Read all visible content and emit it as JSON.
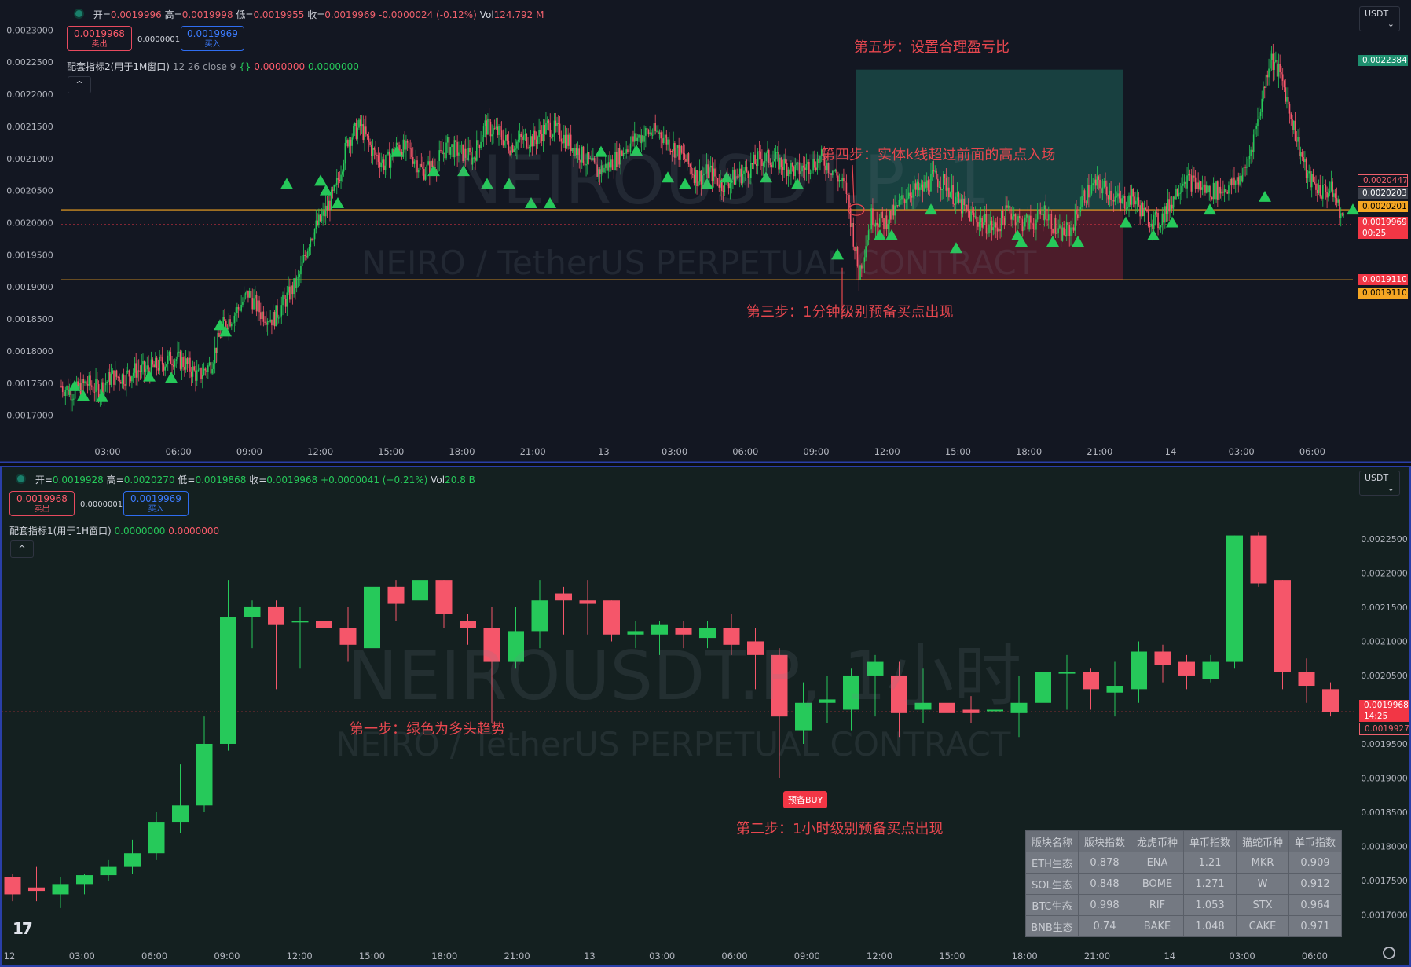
{
  "colors": {
    "up": "#26c95a",
    "down": "#f5566a",
    "hline": "#f5a623",
    "note": "#e8474f",
    "accent": "#2a3fa8"
  },
  "top": {
    "ohlc": {
      "open_label": "开=",
      "open": "0.0019996",
      "high_label": "高=",
      "high": "0.0019998",
      "low_label": "低=",
      "low": "0.0019955",
      "close_label": "收=",
      "close": "0.0019969",
      "change": "-0.0000024 (-0.12%)",
      "vol_label": "Vol",
      "vol": "124.792 M"
    },
    "sell": {
      "price": "0.0019968",
      "label": "卖出"
    },
    "buy": {
      "price": "0.0019969",
      "label": "买入"
    },
    "spread": "0.0000001",
    "indicator": {
      "name": "配套指标2(用于1M窗口)",
      "params": "12 26 close 9",
      "brace_icon": "{}",
      "v1": "0.0000000",
      "v2": "0.0000000"
    },
    "collapse": "^",
    "currency": "USDT",
    "watermark": {
      "symbol": "NEIROUSDT.P, 1",
      "name": "NEIRO / TetherUS PERPETUAL CONTRACT"
    },
    "notes": [
      "第五步：设置合理盈亏比",
      "第四步：实体k线超过前面的高点入场",
      "第三步：1分钟级别预备买点出现"
    ],
    "y_ticks": [
      "0.0023000",
      "0.0022500",
      "0.0022000",
      "0.0021500",
      "0.0021000",
      "0.0020500",
      "0.0020000",
      "0.0019500",
      "0.0019000",
      "0.0018500",
      "0.0018000",
      "0.0017500",
      "0.0017000"
    ],
    "x_ticks": [
      "03:00",
      "06:00",
      "09:00",
      "12:00",
      "15:00",
      "18:00",
      "21:00",
      "13",
      "03:00",
      "06:00",
      "09:00",
      "12:00",
      "15:00",
      "18:00",
      "21:00",
      "14",
      "03:00",
      "06:00"
    ],
    "price_labels": [
      {
        "text": "0.0022384",
        "bg": "#1e8f6f",
        "fg": "#ffffff"
      },
      {
        "text": "0.0020447",
        "bg": "#131722",
        "fg": "#f0616d"
      },
      {
        "text": "0.0020203",
        "bg": "#3b3f4a",
        "fg": "#ffffff"
      },
      {
        "text": "0.0020201",
        "bg": "#f5a623",
        "fg": "#000000"
      },
      {
        "text": "0.0019969",
        "bg": "#f23645",
        "fg": "#ffffff"
      },
      {
        "text": "00:25",
        "bg": "#f23645",
        "fg": "#ffffff"
      },
      {
        "text": "0.0019110",
        "bg": "#f23645",
        "fg": "#ffffff"
      },
      {
        "text": "0.0019110",
        "bg": "#f5a623",
        "fg": "#000000"
      }
    ]
  },
  "bottom": {
    "ohlc": {
      "open_label": "开=",
      "open": "0.0019928",
      "high_label": "高=",
      "high": "0.0020270",
      "low_label": "低=",
      "low": "0.0019868",
      "close_label": "收=",
      "close": "0.0019968",
      "change": "+0.0000041 (+0.21%)",
      "vol_label": "Vol",
      "vol": "20.8 B"
    },
    "sell": {
      "price": "0.0019968",
      "label": "卖出"
    },
    "buy": {
      "price": "0.0019969",
      "label": "买入"
    },
    "spread": "0.0000001",
    "indicator": {
      "name": "配套指标1(用于1H窗口)",
      "v1": "0.0000000",
      "v2": "0.0000000"
    },
    "collapse": "^",
    "currency": "USDT",
    "watermark": {
      "symbol": "NEIROUSDT.P, 1小时",
      "name": "NEIRO / TetherUS PERPETUAL CONTRACT"
    },
    "notes": [
      "第一步：绿色为多头趋势",
      "第二步：1小时级别预备买点出现"
    ],
    "buy_tag": "预备BUY",
    "y_ticks": [
      "0.0022500",
      "0.0022000",
      "0.0021500",
      "0.0021000",
      "0.0020500",
      "0.0020000",
      "0.0019500",
      "0.0019000",
      "0.0018500",
      "0.0018000",
      "0.0017500",
      "0.0017000"
    ],
    "x_ticks": [
      "12",
      "03:00",
      "06:00",
      "09:00",
      "12:00",
      "15:00",
      "18:00",
      "21:00",
      "13",
      "03:00",
      "06:00",
      "09:00",
      "12:00",
      "15:00",
      "18:00",
      "21:00",
      "14",
      "03:00",
      "06:00"
    ],
    "price_labels": [
      {
        "text": "0.0019968",
        "bg": "#f23645",
        "fg": "#ffffff"
      },
      {
        "text": "14:25",
        "bg": "#f23645",
        "fg": "#ffffff"
      },
      {
        "text": "0.0019927",
        "bg": "#142020",
        "fg": "#f0616d"
      }
    ],
    "tv_logo": "17",
    "settings_icon": "gear-icon"
  },
  "sector_table": {
    "headers": [
      "版块名称",
      "版块指数",
      "龙虎币种",
      "单币指数",
      "猫蛇币种",
      "单币指数"
    ],
    "rows": [
      [
        "ETH生态",
        "0.878",
        "ENA",
        "1.21",
        "MKR",
        "0.909"
      ],
      [
        "SOL生态",
        "0.848",
        "BOME",
        "1.271",
        "W",
        "0.912"
      ],
      [
        "BTC生态",
        "0.998",
        "RIF",
        "1.053",
        "STX",
        "0.964"
      ],
      [
        "BNB生态",
        "0.74",
        "BAKE",
        "1.048",
        "CAKE",
        "0.971"
      ]
    ]
  },
  "chart_data": [
    {
      "type": "candlestick",
      "title": "NEIROUSDT.P, 1",
      "interval": "1m",
      "ylim": [
        0.00168,
        0.00232
      ],
      "y_step": 5e-05,
      "x_ticks": [
        "03:00",
        "06:00",
        "09:00",
        "12:00",
        "15:00",
        "18:00",
        "21:00",
        "13",
        "03:00",
        "06:00",
        "09:00",
        "12:00",
        "15:00",
        "18:00",
        "21:00",
        "14",
        "03:00",
        "06:00"
      ],
      "close_path": [
        0.001745,
        0.001735,
        0.00175,
        0.00174,
        0.00176,
        0.00176,
        0.00177,
        0.00177,
        0.00178,
        0.00179,
        0.00178,
        0.00176,
        0.00178,
        0.00184,
        0.00186,
        0.00189,
        0.00186,
        0.00185,
        0.00188,
        0.00191,
        0.00198,
        0.00201,
        0.00205,
        0.00213,
        0.00215,
        0.00211,
        0.00209,
        0.00212,
        0.00211,
        0.00208,
        0.00209,
        0.00212,
        0.00211,
        0.0021,
        0.00215,
        0.00214,
        0.00212,
        0.00213,
        0.00213,
        0.00215,
        0.00214,
        0.00212,
        0.0021,
        0.00208,
        0.00209,
        0.00211,
        0.00213,
        0.00214,
        0.00214,
        0.00212,
        0.0021,
        0.00207,
        0.00208,
        0.00206,
        0.00207,
        0.00208,
        0.0021,
        0.0021,
        0.00209,
        0.00208,
        0.00209,
        0.0021,
        0.00208,
        0.00205,
        0.00192,
        0.00201,
        0.002,
        0.00202,
        0.00205,
        0.00205,
        0.00207,
        0.00206,
        0.00203,
        0.00201,
        0.002,
        0.00199,
        0.00202,
        0.002,
        0.002,
        0.00202,
        0.00198,
        0.00199,
        0.00204,
        0.00206,
        0.00205,
        0.00203,
        0.00204,
        0.00201,
        0.002,
        0.00203,
        0.00207,
        0.00206,
        0.00205,
        0.00205,
        0.00206,
        0.00208,
        0.00216,
        0.00226,
        0.00222,
        0.00214,
        0.00207,
        0.00205,
        0.002049,
        0.0019969
      ],
      "hlines": [
        0.0020201,
        0.001911
      ],
      "current_price": 0.0019969,
      "position": {
        "tp": 0.0022384,
        "entry": 0.0020203,
        "sl": 0.001911
      }
    },
    {
      "type": "candlestick",
      "title": "NEIROUSDT.P, 1小时",
      "interval": "1h",
      "ylim": [
        0.001665,
        0.00232
      ],
      "y_step": 5e-05,
      "x_ticks": [
        "12",
        "03:00",
        "06:00",
        "09:00",
        "12:00",
        "15:00",
        "18:00",
        "21:00",
        "13",
        "03:00",
        "06:00",
        "09:00",
        "12:00",
        "15:00",
        "18:00",
        "21:00",
        "14",
        "03:00",
        "06:00"
      ],
      "candles": [
        {
          "o": 0.001755,
          "h": 0.00176,
          "l": 0.00172,
          "c": 0.00173
        },
        {
          "o": 0.00174,
          "h": 0.00177,
          "l": 0.00172,
          "c": 0.001735
        },
        {
          "o": 0.00173,
          "h": 0.001755,
          "l": 0.00171,
          "c": 0.001745
        },
        {
          "o": 0.001745,
          "h": 0.00176,
          "l": 0.00173,
          "c": 0.001758
        },
        {
          "o": 0.001758,
          "h": 0.00178,
          "l": 0.00175,
          "c": 0.00177
        },
        {
          "o": 0.00177,
          "h": 0.00181,
          "l": 0.00176,
          "c": 0.00179
        },
        {
          "o": 0.00179,
          "h": 0.00185,
          "l": 0.00178,
          "c": 0.001835
        },
        {
          "o": 0.001835,
          "h": 0.00192,
          "l": 0.00182,
          "c": 0.00186
        },
        {
          "o": 0.00186,
          "h": 0.00199,
          "l": 0.00185,
          "c": 0.00195
        },
        {
          "o": 0.00195,
          "h": 0.00219,
          "l": 0.00194,
          "c": 0.002135
        },
        {
          "o": 0.002135,
          "h": 0.00216,
          "l": 0.00209,
          "c": 0.00215
        },
        {
          "o": 0.00215,
          "h": 0.00216,
          "l": 0.00203,
          "c": 0.002125
        },
        {
          "o": 0.00213,
          "h": 0.00215,
          "l": 0.00206,
          "c": 0.00213
        },
        {
          "o": 0.00213,
          "h": 0.00216,
          "l": 0.00208,
          "c": 0.00212
        },
        {
          "o": 0.00212,
          "h": 0.00215,
          "l": 0.00207,
          "c": 0.002095
        },
        {
          "o": 0.00209,
          "h": 0.0022,
          "l": 0.00205,
          "c": 0.00218
        },
        {
          "o": 0.00218,
          "h": 0.00219,
          "l": 0.00213,
          "c": 0.002155
        },
        {
          "o": 0.00216,
          "h": 0.00219,
          "l": 0.00213,
          "c": 0.00219
        },
        {
          "o": 0.00219,
          "h": 0.00219,
          "l": 0.00212,
          "c": 0.00214
        },
        {
          "o": 0.00213,
          "h": 0.00214,
          "l": 0.002095,
          "c": 0.00212
        },
        {
          "o": 0.00212,
          "h": 0.00215,
          "l": 0.00198,
          "c": 0.00207
        },
        {
          "o": 0.00207,
          "h": 0.00215,
          "l": 0.00206,
          "c": 0.002115
        },
        {
          "o": 0.002115,
          "h": 0.00219,
          "l": 0.00209,
          "c": 0.00216
        },
        {
          "o": 0.00217,
          "h": 0.00218,
          "l": 0.00211,
          "c": 0.00216
        },
        {
          "o": 0.00216,
          "h": 0.00219,
          "l": 0.00211,
          "c": 0.002155
        },
        {
          "o": 0.00216,
          "h": 0.00216,
          "l": 0.0021,
          "c": 0.00211
        },
        {
          "o": 0.00211,
          "h": 0.00213,
          "l": 0.00209,
          "c": 0.002115
        },
        {
          "o": 0.00211,
          "h": 0.00213,
          "l": 0.00208,
          "c": 0.002125
        },
        {
          "o": 0.00212,
          "h": 0.00213,
          "l": 0.00209,
          "c": 0.00211
        },
        {
          "o": 0.002105,
          "h": 0.00213,
          "l": 0.00209,
          "c": 0.00212
        },
        {
          "o": 0.00212,
          "h": 0.00214,
          "l": 0.00208,
          "c": 0.002095
        },
        {
          "o": 0.0021,
          "h": 0.00212,
          "l": 0.00203,
          "c": 0.00208
        },
        {
          "o": 0.00208,
          "h": 0.00209,
          "l": 0.0019,
          "c": 0.00199
        },
        {
          "o": 0.00197,
          "h": 0.00204,
          "l": 0.00195,
          "c": 0.00201
        },
        {
          "o": 0.00201,
          "h": 0.00205,
          "l": 0.00198,
          "c": 0.002015
        },
        {
          "o": 0.002,
          "h": 0.00206,
          "l": 0.00197,
          "c": 0.00205
        },
        {
          "o": 0.00205,
          "h": 0.00208,
          "l": 0.00199,
          "c": 0.00207
        },
        {
          "o": 0.00205,
          "h": 0.00207,
          "l": 0.00196,
          "c": 0.001995
        },
        {
          "o": 0.002,
          "h": 0.00206,
          "l": 0.00198,
          "c": 0.00201
        },
        {
          "o": 0.00201,
          "h": 0.00203,
          "l": 0.00196,
          "c": 0.001995
        },
        {
          "o": 0.002,
          "h": 0.00202,
          "l": 0.00198,
          "c": 0.001995
        },
        {
          "o": 0.002,
          "h": 0.00201,
          "l": 0.00197,
          "c": 0.002
        },
        {
          "o": 0.001995,
          "h": 0.00205,
          "l": 0.00196,
          "c": 0.00201
        },
        {
          "o": 0.00201,
          "h": 0.00207,
          "l": 0.002,
          "c": 0.002055
        },
        {
          "o": 0.002055,
          "h": 0.00208,
          "l": 0.002,
          "c": 0.002055
        },
        {
          "o": 0.002055,
          "h": 0.00206,
          "l": 0.002,
          "c": 0.00203
        },
        {
          "o": 0.002025,
          "h": 0.00207,
          "l": 0.00199,
          "c": 0.002035
        },
        {
          "o": 0.00203,
          "h": 0.0021,
          "l": 0.00201,
          "c": 0.002085
        },
        {
          "o": 0.002085,
          "h": 0.002095,
          "l": 0.00204,
          "c": 0.002065
        },
        {
          "o": 0.00207,
          "h": 0.00208,
          "l": 0.00203,
          "c": 0.00205
        },
        {
          "o": 0.002045,
          "h": 0.00208,
          "l": 0.00204,
          "c": 0.00207
        },
        {
          "o": 0.00207,
          "h": 0.002255,
          "l": 0.00206,
          "c": 0.002255
        },
        {
          "o": 0.002255,
          "h": 0.00226,
          "l": 0.00218,
          "c": 0.002185
        },
        {
          "o": 0.00219,
          "h": 0.00219,
          "l": 0.00203,
          "c": 0.002055
        },
        {
          "o": 0.002055,
          "h": 0.002075,
          "l": 0.00201,
          "c": 0.002035
        },
        {
          "o": 0.00203,
          "h": 0.00204,
          "l": 0.00199,
          "c": 0.0019968
        }
      ],
      "hlines": [
        0.0019968
      ],
      "current_price": 0.0019968
    }
  ]
}
